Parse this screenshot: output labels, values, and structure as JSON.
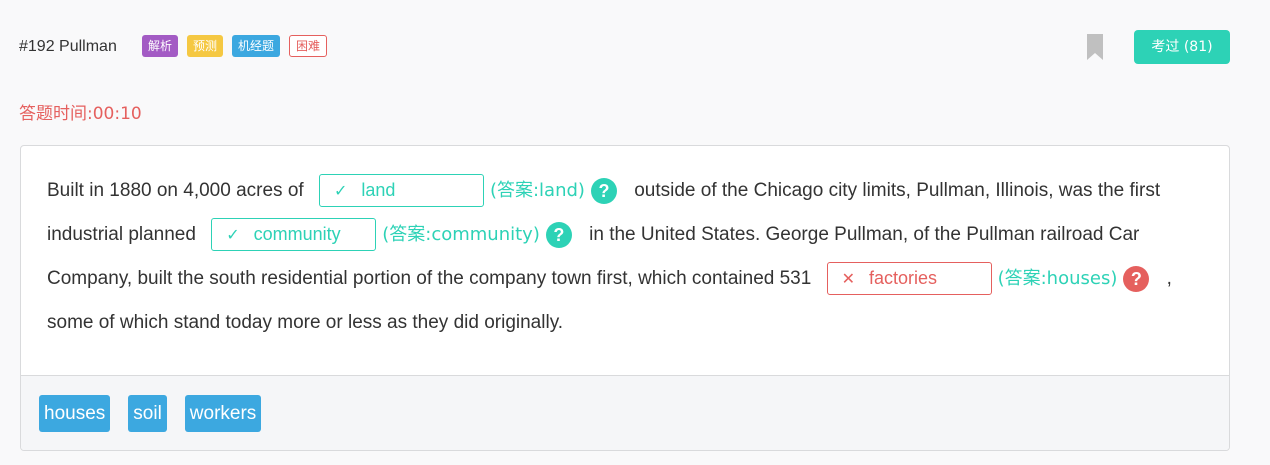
{
  "header": {
    "title": "#192 Pullman",
    "tags": [
      "解析",
      "预测",
      "机经题",
      "困难"
    ],
    "exam_button": "考过 (81)"
  },
  "timer": {
    "label": "答题时间:00:10"
  },
  "colors": {
    "correct": "#2dd2b6",
    "wrong": "#e5605e",
    "tag_blue": "#3ca8e0",
    "tag_purple": "#a35bc4",
    "tag_yellow": "#f5c842"
  },
  "passage": {
    "seg1": "Built in 1880 on 4,000 acres of",
    "blank1": {
      "mark": "✓",
      "value": "land",
      "answer": "(答案:land)",
      "help": "?"
    },
    "seg2": "outside of the Chicago city limits, Pullman, Illinois, was the first industrial planned",
    "blank2": {
      "mark": "✓",
      "value": "community",
      "answer": "(答案:community)",
      "help": "?"
    },
    "seg3": "in the United States. George Pullman, of the Pullman railroad Car Company, built the south residential portion of the company town first, which contained 531",
    "blank3": {
      "mark": "✕",
      "value": "factories",
      "answer": "(答案:houses)",
      "help": "?"
    },
    "seg4": ", some of which stand today more or less as they did originally."
  },
  "options": [
    "houses",
    "soil",
    "workers"
  ]
}
